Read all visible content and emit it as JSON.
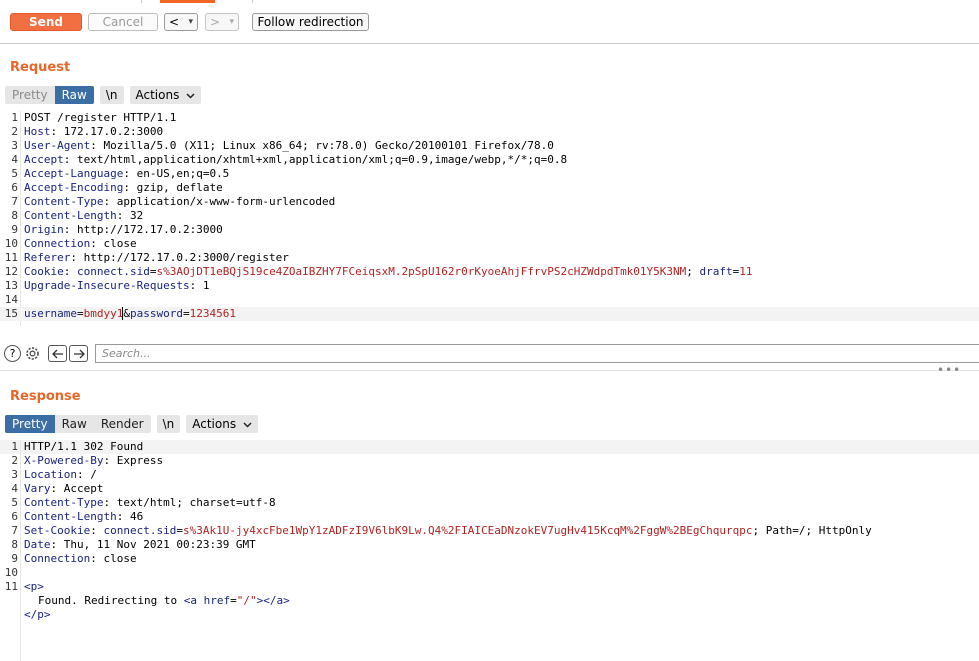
{
  "toolbar": {
    "send_label": "Send",
    "cancel_label": "Cancel",
    "back_glyph": "<",
    "forward_glyph": ">",
    "dropdown_glyph": "▾",
    "follow_label": "Follow redirection"
  },
  "request": {
    "title": "Request",
    "tabs": {
      "pretty": "Pretty",
      "raw": "Raw",
      "newline": "\\n",
      "actions": "Actions"
    },
    "line_numbers": [
      "1",
      "2",
      "3",
      "4",
      "5",
      "6",
      "7",
      "8",
      "9",
      "10",
      "11",
      "12",
      "13",
      "14",
      "15"
    ],
    "request_line": "POST /register HTTP/1.1",
    "headers": [
      {
        "name": "Host",
        "value": "172.17.0.2:3000"
      },
      {
        "name": "User-Agent",
        "value": "Mozilla/5.0 (X11; Linux x86_64; rv:78.0) Gecko/20100101 Firefox/78.0"
      },
      {
        "name": "Accept",
        "value": "text/html,application/xhtml+xml,application/xml;q=0.9,image/webp,*/*;q=0.8"
      },
      {
        "name": "Accept-Language",
        "value": "en-US,en;q=0.5"
      },
      {
        "name": "Accept-Encoding",
        "value": "gzip, deflate"
      },
      {
        "name": "Content-Type",
        "value": "application/x-www-form-urlencoded"
      },
      {
        "name": "Content-Length",
        "value": "32"
      },
      {
        "name": "Origin",
        "value": "http://172.17.0.2:3000"
      },
      {
        "name": "Connection",
        "value": "close"
      },
      {
        "name": "Referer",
        "value": "http://172.17.0.2:3000/register"
      }
    ],
    "cookie": {
      "name": "Cookie",
      "key1": "connect.sid",
      "val1": "s%3AOjDT1eBQjS19ce4ZOaIBZHY7FCeiqsxM.2pSpU162r0rKyoeAhjFfrvPS2cHZWdpdTmk01Y5K3NM",
      "key2": "draft",
      "val2": "11"
    },
    "upgrade": {
      "name": "Upgrade-Insecure-Requests",
      "value": "1"
    },
    "body": {
      "k1": "username",
      "v1": "bmdyy1",
      "k2": "password",
      "v2": "1234561"
    }
  },
  "search": {
    "placeholder": "Search..."
  },
  "response": {
    "title": "Response",
    "tabs": {
      "pretty": "Pretty",
      "raw": "Raw",
      "render": "Render",
      "newline": "\\n",
      "actions": "Actions"
    },
    "line_numbers": [
      "1",
      "2",
      "3",
      "4",
      "5",
      "6",
      "7",
      "8",
      "9",
      "10",
      "11"
    ],
    "status_line": "HTTP/1.1 302 Found",
    "headers": [
      {
        "name": "X-Powered-By",
        "value": "Express"
      },
      {
        "name": "Location",
        "value": "/"
      },
      {
        "name": "Vary",
        "value": "Accept"
      },
      {
        "name": "Content-Type",
        "value": "text/html; charset=utf-8"
      },
      {
        "name": "Content-Length",
        "value": "46"
      }
    ],
    "set_cookie": {
      "name": "Set-Cookie",
      "key": "connect.sid",
      "value": "s%3Ak1U-jy4xcFbe1WpY1zADFzI9V6lbK9Lw.Q4%2FIAICEaDNzokEV7ugHv415KcqM%2FggW%2BEgChqurqpc",
      "rest": "; Path=/; HttpOnly"
    },
    "headers2": [
      {
        "name": "Date",
        "value": "Thu, 11 Nov 2021 00:23:39 GMT"
      },
      {
        "name": "Connection",
        "value": "close"
      }
    ],
    "html_open_p": "<p>",
    "html_text": "Found. Redirecting to ",
    "html_a_open": "<a",
    "html_attr": "href",
    "html_attr_val": "\"/\"",
    "html_a_close": "></a>",
    "html_close_p": "</p>"
  }
}
